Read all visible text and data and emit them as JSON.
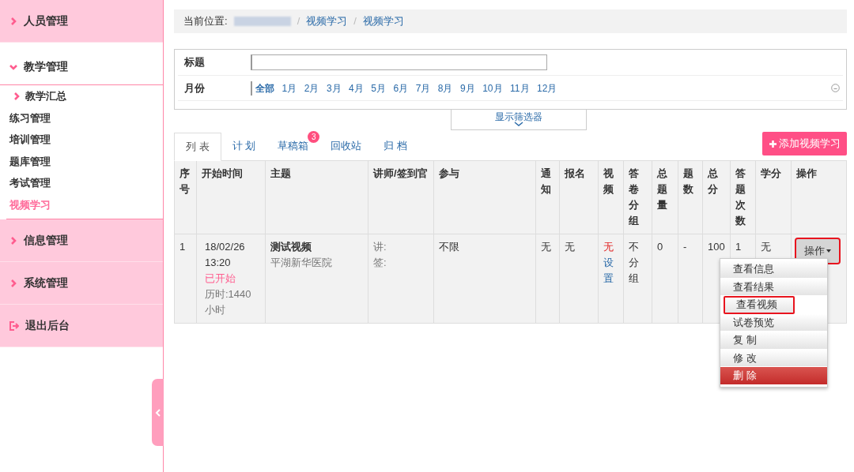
{
  "sidebar": {
    "items": [
      {
        "kind": "group",
        "label": "人员管理",
        "expanded": false
      },
      {
        "kind": "group",
        "label": "教学管理",
        "expanded": true,
        "children": [
          {
            "label": "教学汇总",
            "kind": "folder",
            "selected": false
          },
          {
            "label": "练习管理",
            "kind": "link",
            "selected": false
          },
          {
            "label": "培训管理",
            "kind": "link",
            "selected": false
          },
          {
            "label": "题库管理",
            "kind": "link",
            "selected": false
          },
          {
            "label": "考试管理",
            "kind": "link",
            "selected": false
          },
          {
            "label": "视频学习",
            "kind": "link",
            "selected": true
          }
        ]
      },
      {
        "kind": "group",
        "label": "信息管理",
        "expanded": false
      },
      {
        "kind": "group",
        "label": "系统管理",
        "expanded": false
      },
      {
        "kind": "logout",
        "label": "退出后台",
        "expanded": false
      }
    ]
  },
  "breadcrumb": {
    "label": "当前位置:",
    "separator": "/",
    "links": [
      "视频学习",
      "视频学习"
    ]
  },
  "filter": {
    "title_label": "标题",
    "month_label": "月份",
    "months": [
      {
        "label": "全部",
        "selected": true
      },
      {
        "label": "1月",
        "selected": false
      },
      {
        "label": "2月",
        "selected": false
      },
      {
        "label": "3月",
        "selected": false
      },
      {
        "label": "4月",
        "selected": false
      },
      {
        "label": "5月",
        "selected": false
      },
      {
        "label": "6月",
        "selected": false
      },
      {
        "label": "7月",
        "selected": false
      },
      {
        "label": "8月",
        "selected": false
      },
      {
        "label": "9月",
        "selected": false
      },
      {
        "label": "10月",
        "selected": false
      },
      {
        "label": "11月",
        "selected": false
      },
      {
        "label": "12月",
        "selected": false
      }
    ],
    "toggle": "显示筛选器"
  },
  "tabs": [
    {
      "label": "列 表",
      "selected": true
    },
    {
      "label": "计 划",
      "selected": false
    },
    {
      "label": "草稿箱",
      "selected": false,
      "badge": "3"
    },
    {
      "label": "回收站",
      "selected": false
    },
    {
      "label": "归 档",
      "selected": false
    }
  ],
  "add_button": "添加视频学习",
  "table": {
    "columns": [
      "序号",
      "开始时间",
      "主题",
      "讲师/签到官",
      "参与",
      "通知",
      "报名",
      "视频",
      "答卷分组",
      "总题量",
      "题数",
      "总分",
      "答题次数",
      "学分",
      "操作"
    ],
    "rows": [
      {
        "index": "1",
        "date": "18/02/26 13:20",
        "status": "已开始",
        "duration": "历时:1440小时",
        "title": "测试视频",
        "org": "平湖新华医院",
        "lecturer": "讲:",
        "checker": "签:",
        "participants": "不限",
        "notify": "无",
        "signup": "无",
        "video_none": "无",
        "video_link": "设置",
        "grouping": "不分组",
        "total_questions": "0",
        "questions": "-",
        "score": "100",
        "attempts": "1",
        "credit": "无",
        "action": {
          "label": "操作",
          "highlighted": true
        }
      }
    ]
  },
  "menu": [
    {
      "label": "查看信息",
      "kind": "normal",
      "highlighted": false
    },
    {
      "label": "查看结果",
      "kind": "normal",
      "highlighted": false
    },
    {
      "label": "查看视频",
      "kind": "normal",
      "highlighted": true
    },
    {
      "label": "试卷预览",
      "kind": "normal",
      "highlighted": false
    },
    {
      "label": "复 制",
      "kind": "normal",
      "highlighted": false
    },
    {
      "label": "修 改",
      "kind": "normal",
      "highlighted": false
    },
    {
      "label": "删 除",
      "kind": "danger",
      "highlighted": false
    }
  ]
}
